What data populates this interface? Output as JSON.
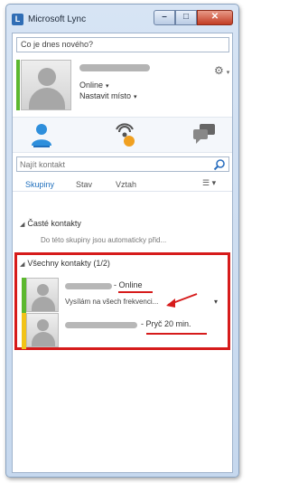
{
  "window": {
    "title": "Microsoft Lync"
  },
  "window_controls": {
    "minimize": "–",
    "maximize": "□",
    "close": "✕"
  },
  "me": {
    "note_placeholder": "Co je dnes nového?",
    "status": "Online",
    "location": "Nastavit místo",
    "presence_color": "#5cb82f"
  },
  "icons": {
    "contacts": "contacts-icon",
    "activity": "activity-feed-icon",
    "conversations": "conversations-icon",
    "search": "search-icon",
    "settings": "gear-icon"
  },
  "search": {
    "placeholder": "Najít kontakt"
  },
  "view_tabs": [
    "Skupiny",
    "Stav",
    "Vztah"
  ],
  "groups": [
    {
      "name": "Časté kontakty",
      "empty_text": "Do této skupiny jsou automaticky přid..."
    },
    {
      "name": "Všechny kontakty (1/2)",
      "contacts": [
        {
          "status": "- Online",
          "note": "Vysílám na všech frekvenci...",
          "presence_color": "#5cb82f"
        },
        {
          "status": "- Pryč 20 min.",
          "note": "",
          "presence_color": "#f2c318"
        }
      ]
    }
  ],
  "colors": {
    "annotation": "#d61b1b",
    "accent": "#1f6fbd"
  }
}
